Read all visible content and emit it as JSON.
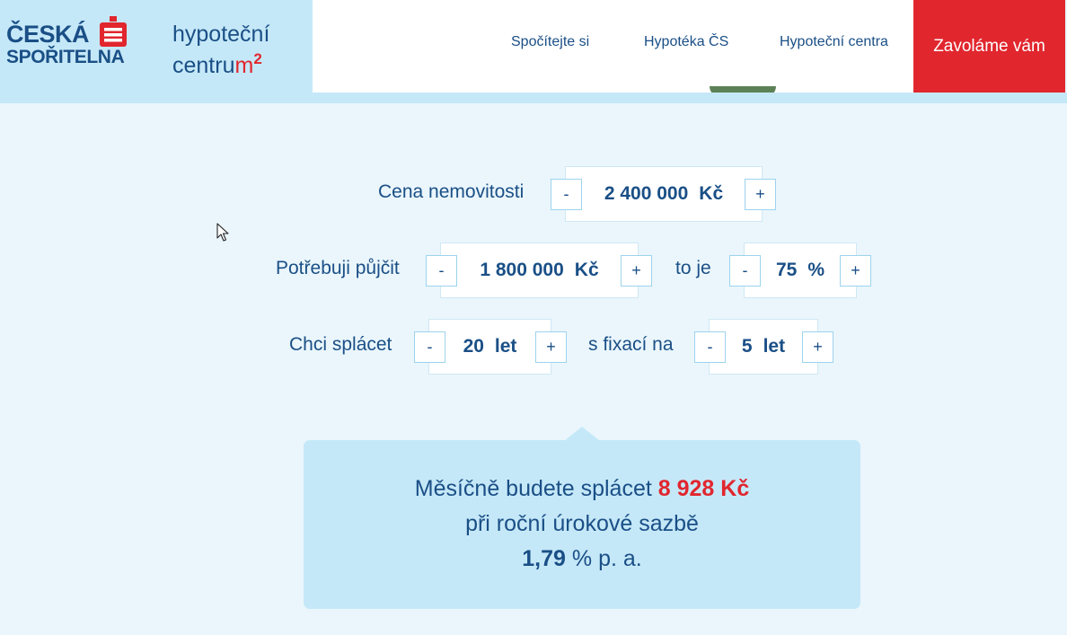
{
  "brand": {
    "logo_line1": "ČESKÁ",
    "logo_line2": "SPOŘITELNA",
    "hc_title": "hypoteční",
    "hc_sub_prefix": "centru",
    "hc_sub_m": "m",
    "hc_sub_sup": "2"
  },
  "nav": {
    "items": [
      "Spočítejte si",
      "Hypotéka ČS",
      "Hypoteční centra"
    ],
    "cta": "Zavoláme vám"
  },
  "calc": {
    "price_label": "Cena nemovitosti",
    "price_value": "2 400 000",
    "price_unit": "Kč",
    "loan_label": "Potřebuji půjčit",
    "loan_value": "1 800 000",
    "loan_unit": "Kč",
    "ratio_label": "to je",
    "ratio_value": "75",
    "ratio_unit": "%",
    "years_label": "Chci splácet",
    "years_value": "20",
    "years_unit": "let",
    "fix_label": "s fixací na",
    "fix_value": "5",
    "fix_unit": "let",
    "minus": "-",
    "plus": "+"
  },
  "result": {
    "line1_prefix": "Měsíčně budete splácet",
    "amount": "8 928 Kč",
    "line2": "při roční úrokové sazbě",
    "rate": "1,79",
    "rate_suffix": "% p. a."
  },
  "colors": {
    "brand_blue": "#1a4f86",
    "accent_red": "#e1262e",
    "light_blue": "#c5e8f8",
    "page_bg": "#eaf6fc"
  }
}
